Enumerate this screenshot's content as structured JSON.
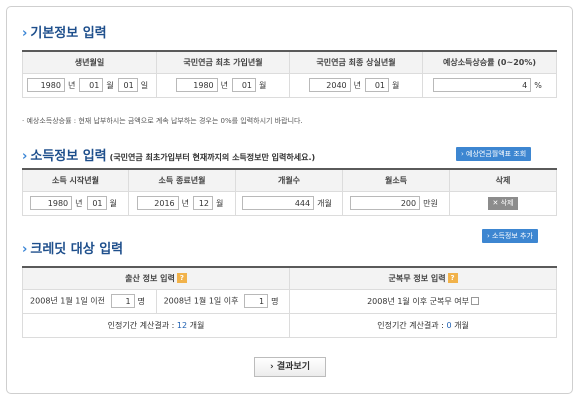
{
  "basic": {
    "title": "기본정보 입력",
    "headers": [
      "생년월일",
      "국민연금 최초 가입년월",
      "국민연금 최종 상실년월",
      "예상소득상승률 (0~20%)"
    ],
    "birth": {
      "year": "1980",
      "month": "01",
      "day": "01"
    },
    "first_join": {
      "year": "1980",
      "month": "01"
    },
    "final_loss": {
      "year": "2040",
      "month": "01"
    },
    "growth_rate": "4",
    "units": {
      "year": "년",
      "month": "월",
      "day": "일",
      "percent": "%"
    },
    "note": "· 예상소득상승률 : 현재 납부하시는 금액으로 계속 납부하는 경우는 0%를 입력하시기 바랍니다."
  },
  "income": {
    "title": "소득정보 입력",
    "subtitle": "(국민연금 최초가입부터 현재까지의 소득정보만 입력하세요.)",
    "lookup_button": "› 예상연금월액표 조회",
    "headers": [
      "소득 시작년월",
      "소득 종료년월",
      "개월수",
      "월소득",
      "삭제"
    ],
    "row": {
      "start_year": "1980",
      "start_month": "01",
      "end_year": "2016",
      "end_month": "12",
      "months": "444",
      "months_unit": "개월",
      "monthly_income": "200",
      "income_unit": "만원",
      "delete_label": "✕ 삭제"
    },
    "add_button": "› 소득정보 추가"
  },
  "credit": {
    "title": "크레딧 대상 입력",
    "birth_header": "출산 정보 입력",
    "military_header": "군복무 정보 입력",
    "before_label": "2008년 1월 1일 이전",
    "before_value": "1",
    "after_label": "2008년 1월 1일 이후",
    "after_value": "1",
    "person_unit": "명",
    "military_label": "2008년 1월 이후 군복무 여부",
    "birth_result_label": "인정기간 계산결과 :",
    "birth_result_value": "12",
    "military_result_label": "인정기간 계산결과 :",
    "military_result_value": "0",
    "result_unit": "개월",
    "help": "?"
  },
  "result_button": "› 결과보기"
}
